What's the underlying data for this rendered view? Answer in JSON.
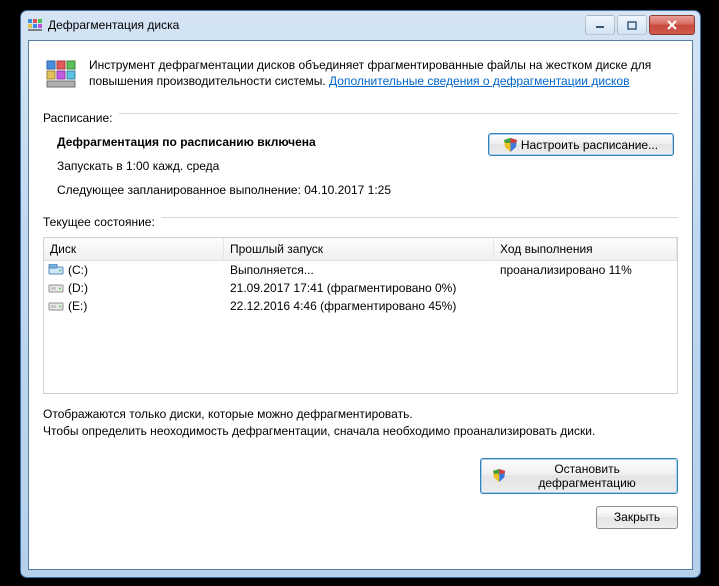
{
  "window": {
    "title": "Дефрагментация диска"
  },
  "intro": {
    "text": "Инструмент дефрагментации дисков объединяет фрагментированные файлы на жестком диске для повышения производительности системы. ",
    "link": "Дополнительные сведения о дефрагментации дисков"
  },
  "labels": {
    "schedule_section": "Расписание:",
    "status_section": "Текущее состояние:"
  },
  "schedule": {
    "title": "Дефрагментация по расписанию включена",
    "run_at": "Запускать в 1:00 кажд. среда",
    "next_run": "Следующее запланированное выполнение: 04.10.2017 1:25"
  },
  "buttons": {
    "configure_schedule": "Настроить расписание...",
    "stop_defrag": "Остановить дефрагментацию",
    "close": "Закрыть"
  },
  "list": {
    "headers": {
      "disk": "Диск",
      "last_run": "Прошлый запуск",
      "progress": "Ход выполнения"
    },
    "rows": [
      {
        "icon": "primary",
        "disk": "(C:)",
        "last_run": "Выполняется...",
        "progress": "проанализировано 11%"
      },
      {
        "icon": "hdd",
        "disk": "(D:)",
        "last_run": "21.09.2017 17:41 (фрагментировано 0%)",
        "progress": ""
      },
      {
        "icon": "hdd",
        "disk": "(E:)",
        "last_run": "22.12.2016 4:46 (фрагментировано 45%)",
        "progress": ""
      }
    ]
  },
  "footer": {
    "line1": "Отображаются только диски, которые можно дефрагментировать.",
    "line2": "Чтобы определить неоходимость дефрагментации, сначала необходимо проанализировать диски."
  }
}
